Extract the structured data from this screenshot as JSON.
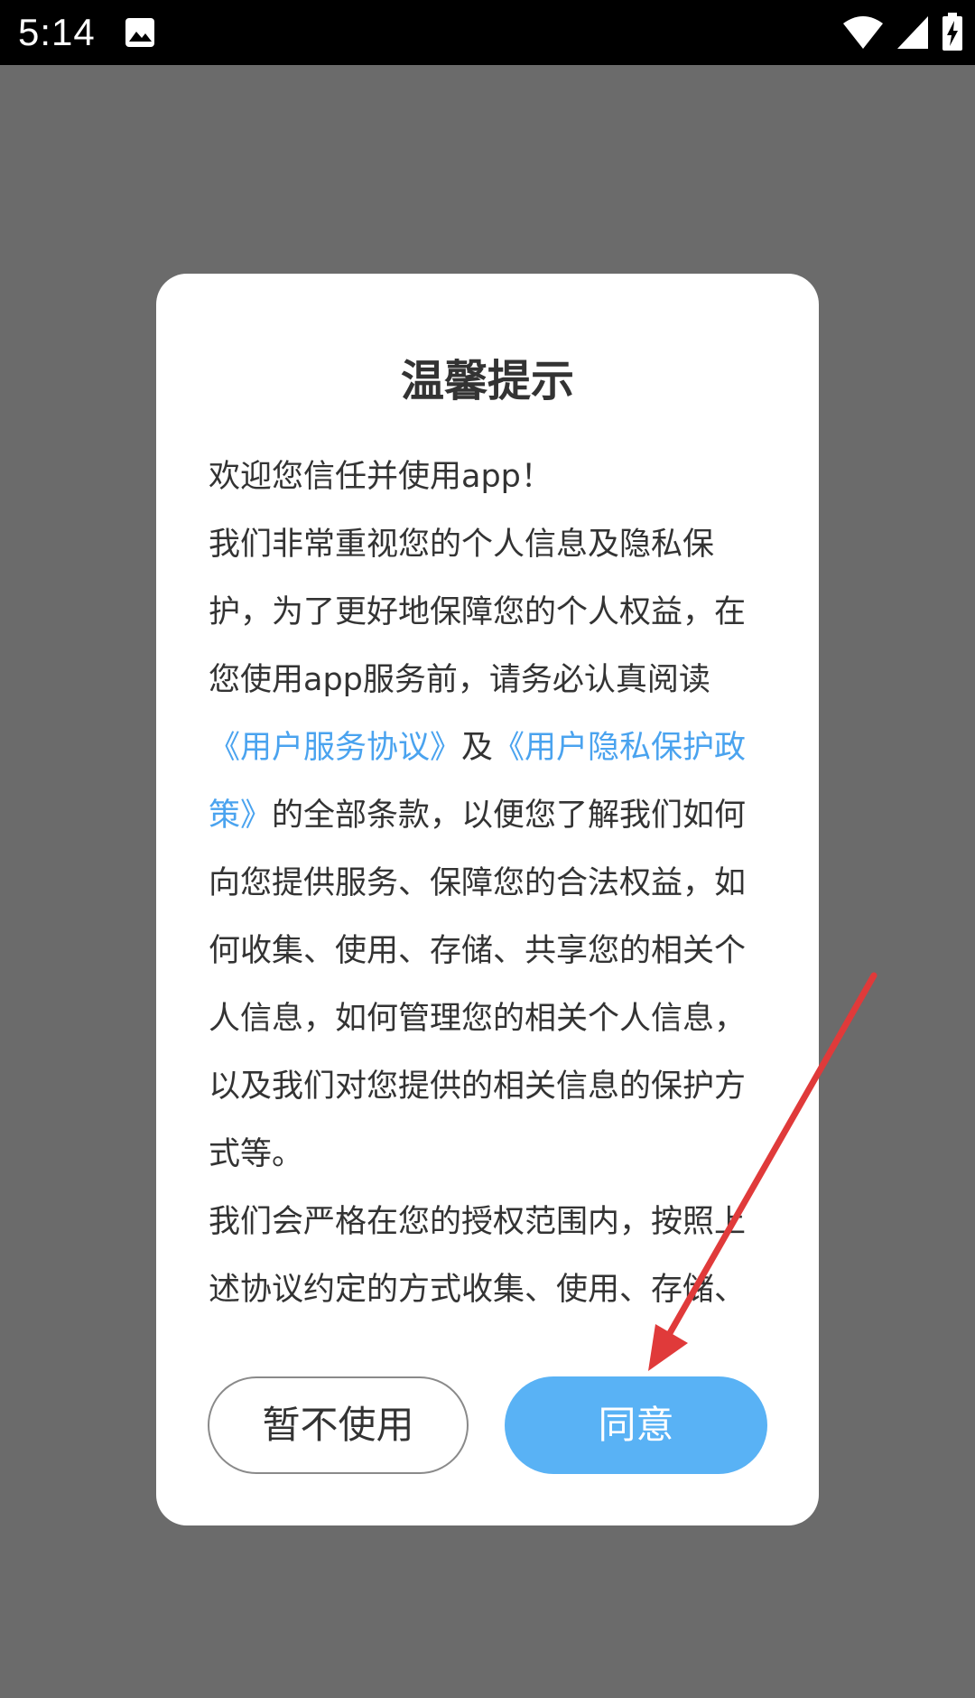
{
  "status_bar": {
    "time": "5:14",
    "icons": [
      "image-icon",
      "wifi-icon",
      "cell-signal-icon",
      "battery-charging-icon"
    ]
  },
  "dialog": {
    "title": "温馨提示",
    "welcome": "欢迎您信任并使用app！",
    "para1_text_a": "我们非常重视您的个人信息及隐私保护，为了更好地保障您的个人权益，在您使用app服务前，请务必认真阅读",
    "link_user_agreement": "《用户服务协议》",
    "conjunction": "及",
    "link_privacy_policy": "《用户隐私保护政策》",
    "para1_text_b": "的全部条款，以便您了解我们如何向您提供服务、保障您的合法权益，如何收集、使用、存储、共享您的相关个人信息，如何管理您的相关个人信息，以及我们对您提供的相关信息的保护方式等。",
    "para2": "我们会严格在您的授权范围内，按照上述协议约定的方式收集、使用、存储、共享您的相关个人信息。",
    "decline_label": "暂不使用",
    "agree_label": "同意"
  },
  "colors": {
    "link": "#4aa3ef",
    "agree_button": "#59b2f5",
    "annotation_arrow": "#e03a3a",
    "overlay": "#6b6b6b"
  }
}
